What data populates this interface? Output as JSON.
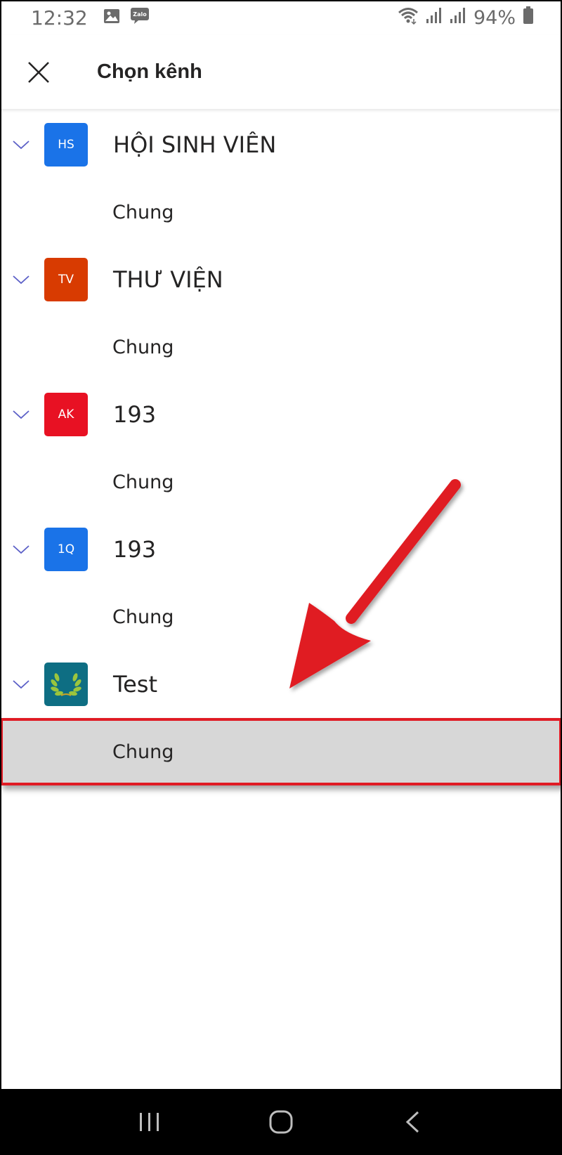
{
  "status_bar": {
    "time": "12:32",
    "battery": "94%",
    "icons": [
      "gallery-icon",
      "zalo-icon",
      "wifi-icon",
      "signal-icon",
      "signal-icon",
      "battery-icon"
    ],
    "zalo_label": "Zalo"
  },
  "header": {
    "title": "Chọn kênh",
    "close_icon": "close-icon"
  },
  "teams": [
    {
      "initials": "HS",
      "name": "HỘI SINH VIÊN",
      "color": "#1a73e8",
      "channels": [
        "Chung"
      ]
    },
    {
      "initials": "TV",
      "name": "THƯ VIỆN",
      "color": "#d83b01",
      "channels": [
        "Chung"
      ]
    },
    {
      "initials": "AK",
      "name": "193",
      "color": "#e81123",
      "channels": [
        "Chung"
      ]
    },
    {
      "initials": "1Q",
      "name": "193",
      "color": "#1a73e8",
      "channels": [
        "Chung"
      ]
    },
    {
      "initials": "",
      "name": "Test",
      "color": "#0e6e83",
      "avatar_icon": "laurel-wreath-icon",
      "channels": [
        "Chung"
      ]
    }
  ],
  "selected": {
    "team_index": 4,
    "channel": "Chung"
  },
  "annotation": {
    "color": "#e01b24",
    "icon": "red-arrow-annotation"
  },
  "nav_bar": {
    "buttons": [
      "recent-apps-icon",
      "home-icon",
      "back-icon"
    ]
  }
}
